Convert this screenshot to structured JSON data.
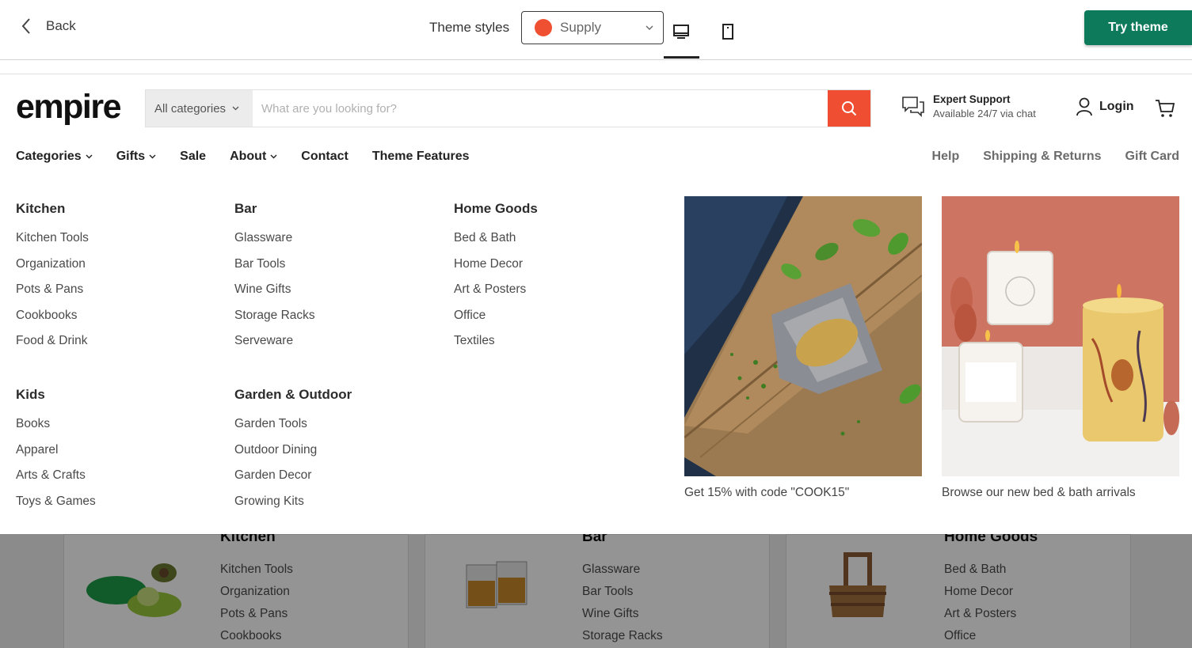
{
  "preview_bar": {
    "back_label": "Back",
    "theme_label": "Theme styles",
    "theme_selected": "Supply",
    "theme_color": "#f05032",
    "try_label": "Try theme",
    "try_color": "#0d7a5c",
    "icons": {
      "desktop": "desktop-icon",
      "mobile": "mobile-icon"
    }
  },
  "header": {
    "logo": "empire",
    "search_category": "All categories",
    "search_placeholder": "What are you looking for?",
    "support_title": "Expert Support",
    "support_subtitle": "Available 24/7 via chat",
    "login_label": "Login",
    "accent_color": "#f04e32"
  },
  "nav": {
    "left": [
      "Categories",
      "Gifts",
      "Sale",
      "About",
      "Contact",
      "Theme Features"
    ],
    "right": [
      "Help",
      "Shipping & Returns",
      "Gift Card"
    ]
  },
  "mega_menu": {
    "columns": [
      {
        "title": "Kitchen",
        "links": [
          "Kitchen Tools",
          "Organization",
          "Pots & Pans",
          "Cookbooks",
          "Food & Drink"
        ]
      },
      {
        "title": "Bar",
        "links": [
          "Glassware",
          "Bar Tools",
          "Wine Gifts",
          "Storage Racks",
          "Serveware"
        ]
      },
      {
        "title": "Home Goods",
        "links": [
          "Bed & Bath",
          "Home Decor",
          "Art & Posters",
          "Office",
          "Textiles"
        ]
      },
      {
        "title": "Kids",
        "links": [
          "Books",
          "Apparel",
          "Arts & Crafts",
          "Toys & Games"
        ]
      },
      {
        "title": "Garden & Outdoor",
        "links": [
          "Garden Tools",
          "Outdoor Dining",
          "Garden Decor",
          "Growing Kits"
        ]
      }
    ],
    "promos": [
      {
        "caption": "Get 15% with code \"COOK15\""
      },
      {
        "caption": "Browse our new bed & bath arrivals"
      }
    ]
  },
  "below_cards": [
    {
      "title": "Kitchen",
      "links": [
        "Kitchen Tools",
        "Organization",
        "Pots & Pans",
        "Cookbooks"
      ]
    },
    {
      "title": "Bar",
      "links": [
        "Glassware",
        "Bar Tools",
        "Wine Gifts",
        "Storage Racks"
      ]
    },
    {
      "title": "Home Goods",
      "links": [
        "Bed & Bath",
        "Home Decor",
        "Art & Posters",
        "Office"
      ]
    }
  ]
}
